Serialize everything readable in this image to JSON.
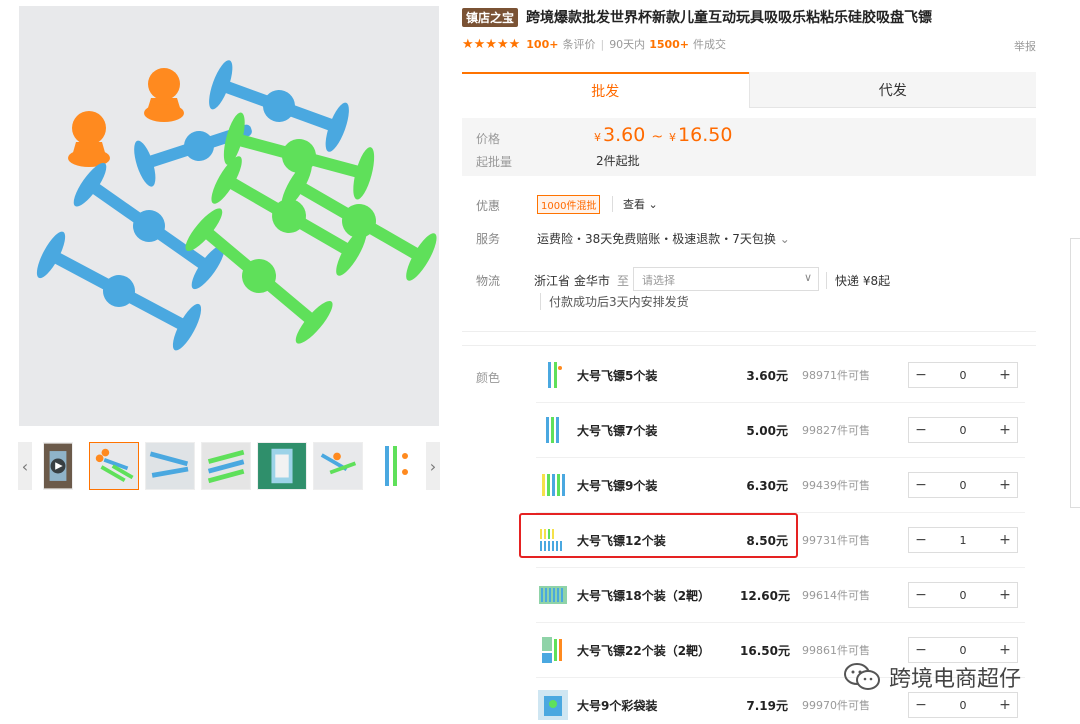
{
  "product": {
    "shop_badge": "镇店之宝",
    "title": "跨境爆款批发世界杯新款儿童互动玩具吸吸乐粘粘乐硅胶吸盘飞镖",
    "stars": "★★★★★",
    "review_count": "100+",
    "review_suffix": "条评价",
    "sales_prefix": "90天内",
    "sales_count": "1500+",
    "sales_suffix": "件成交",
    "report": "举报"
  },
  "tabs": [
    {
      "label": "批发"
    },
    {
      "label": "代发"
    }
  ],
  "price": {
    "label": "价格",
    "currency": "¥",
    "min": "3.60",
    "separator": "~",
    "max": "16.50",
    "moq_label": "起批量",
    "moq": "2件起批"
  },
  "info": {
    "promo_label": "优惠",
    "promo_tag": "1000件混批",
    "promo_view": "查看",
    "service_label": "服务",
    "service_text": "运费险・38天免费赔账・极速退款・7天包换",
    "logistics_label": "物流",
    "from": "浙江省 金华市",
    "to": "至",
    "dest_placeholder": "请选择",
    "shipping": "快递 ¥8起",
    "ship_note": "付款成功后3天内安排发货"
  },
  "sku": {
    "label": "颜色",
    "rows": [
      {
        "name": "大号飞镖5个装",
        "price": "3.60元",
        "stock": "98971件可售",
        "qty": "0"
      },
      {
        "name": "大号飞镖7个装",
        "price": "5.00元",
        "stock": "99827件可售",
        "qty": "0"
      },
      {
        "name": "大号飞镖9个装",
        "price": "6.30元",
        "stock": "99439件可售",
        "qty": "0"
      },
      {
        "name": "大号飞镖12个装",
        "price": "8.50元",
        "stock": "99731件可售",
        "qty": "1"
      },
      {
        "name": "大号飞镖18个装（2靶）",
        "price": "12.60元",
        "stock": "99614件可售",
        "qty": "0"
      },
      {
        "name": "大号飞镖22个装（2靶）",
        "price": "16.50元",
        "stock": "99861件可售",
        "qty": "0"
      },
      {
        "name": "大号9个彩袋装",
        "price": "7.19元",
        "stock": "99970件可售",
        "qty": "0"
      }
    ],
    "minus": "−",
    "plus": "+"
  },
  "gallery": {
    "prev": "‹",
    "next": "›"
  },
  "watermark": {
    "text": "跨境电商超仔"
  },
  "colors": {
    "accent": "#ff6a00",
    "highlight": "#e52222",
    "badge": "#7a5234"
  }
}
